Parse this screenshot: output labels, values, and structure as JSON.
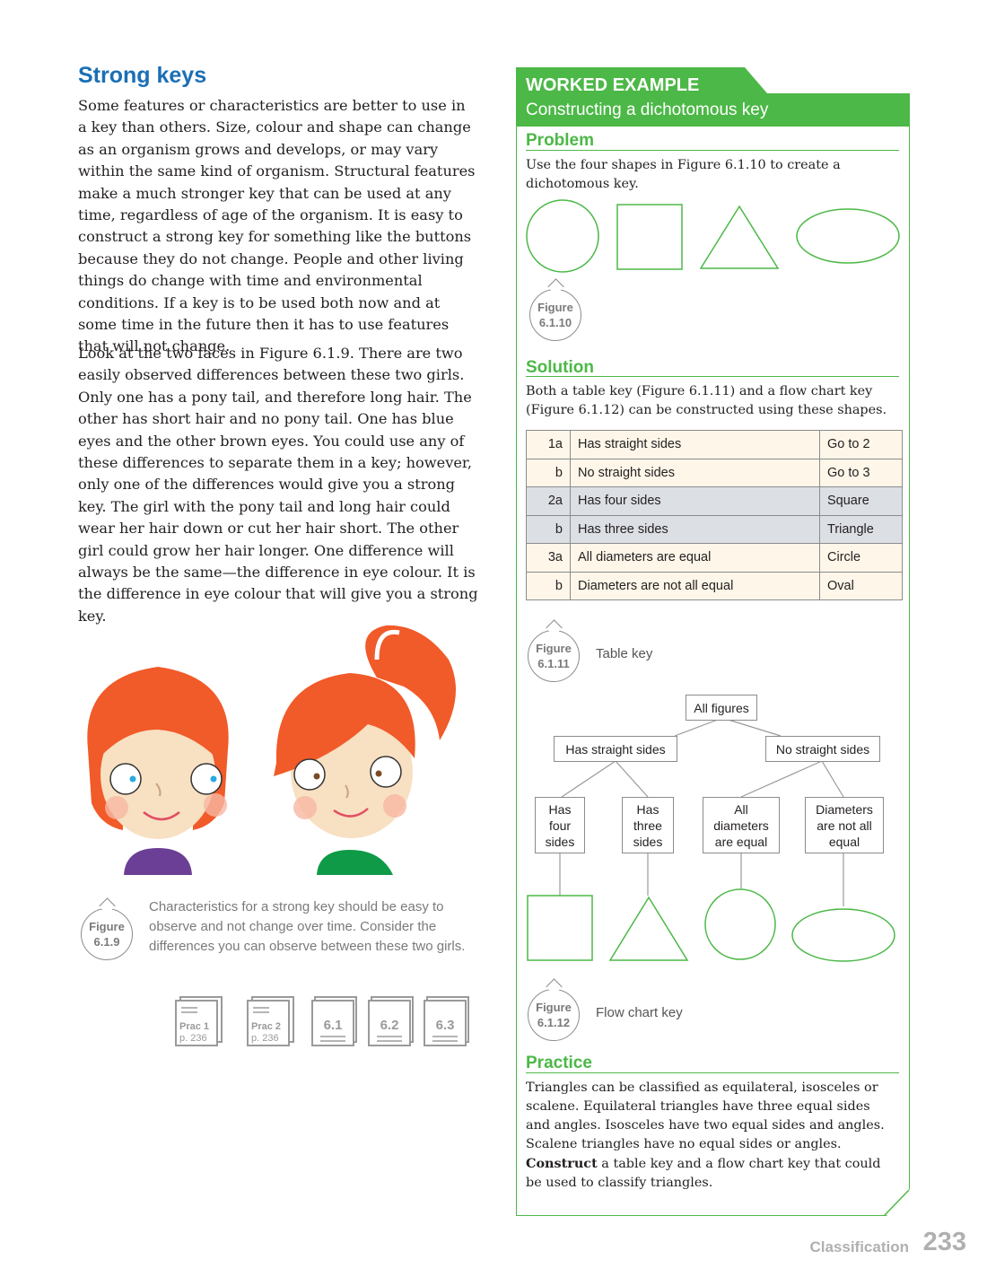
{
  "left": {
    "title": "Strong keys",
    "para1": "Some features or characteristics are better to use in a key than others. Size, colour and shape can change as an organism grows and develops, or may vary within the same kind of organism. Structural features make a much stronger key that can be used at any time, regardless of age of the organism. It is easy to construct a strong key for something like the buttons because they do not change. People and other living things do change with time and environmental conditions. If a key is to be used both now and at some time in the future then it has to use features that will not change.",
    "para2": "Look at the two faces in Figure 6.1.9. There are two easily observed differences between these two girls. Only one has a pony tail, and therefore long hair. The other has short hair and no pony tail. One has blue eyes and the other brown eyes. You could use any of these differences to separate them in a key; however, only one of the differences would give you a strong key. The girl with the pony tail and long hair could wear her hair down or cut her hair short. The other girl could grow her hair longer. One difference will always be the same—the difference in eye colour. It is the difference in eye colour that will give you a strong key.",
    "figure_619": {
      "label": "Figure",
      "number": "6.1.9"
    },
    "caption_619": "Characteristics for a strong key should be easy to observe and not change over time. Consider the differences you can observe between these two girls.",
    "resources": [
      {
        "line1": "Prac 1",
        "line2": "p. 236"
      },
      {
        "line1": "Prac 2",
        "line2": "p. 236"
      },
      {
        "label": "6.1"
      },
      {
        "label": "6.2"
      },
      {
        "label": "6.3"
      }
    ]
  },
  "worked_example": {
    "tab_title": "WORKED EXAMPLE",
    "subtitle": "Constructing a dichotomous key",
    "problem_heading": "Problem",
    "problem_text": "Use the four shapes in Figure 6.1.10 to create a dichotomous key.",
    "figure_6110": {
      "label": "Figure",
      "number": "6.1.10"
    },
    "solution_heading": "Solution",
    "solution_text": "Both a table key (Figure 6.1.11) and a flow chart key (Figure 6.1.12) can be constructed using these shapes.",
    "table_rows": [
      {
        "step": "1a",
        "feature": "Has straight sides",
        "result": "Go to 2"
      },
      {
        "step": "b",
        "feature": "No straight sides",
        "result": "Go to 3"
      },
      {
        "step": "2a",
        "feature": "Has four sides",
        "result": "Square"
      },
      {
        "step": "b",
        "feature": "Has three sides",
        "result": "Triangle"
      },
      {
        "step": "3a",
        "feature": "All diameters are equal",
        "result": "Circle"
      },
      {
        "step": "b",
        "feature": "Diameters are not all equal",
        "result": "Oval"
      }
    ],
    "figure_6111": {
      "label": "Figure",
      "number": "6.1.11",
      "caption": "Table key"
    },
    "flow": {
      "root": "All figures",
      "left": "Has straight sides",
      "right": "No straight sides",
      "leaf1": [
        "Has",
        "four",
        "sides"
      ],
      "leaf2": [
        "Has",
        "three",
        "sides"
      ],
      "leaf3": [
        "All",
        "diameters",
        "are equal"
      ],
      "leaf4": [
        "Diameters",
        "are not all",
        "equal"
      ]
    },
    "figure_6112": {
      "label": "Figure",
      "number": "6.1.12",
      "caption": "Flow chart key"
    },
    "practice_heading": "Practice",
    "practice_text": "Triangles can be classified as equilateral, isosceles or scalene. Equilateral triangles have three equal sides and angles. Isosceles have two equal sides and angles. Scalene triangles have no equal sides or angles.",
    "practice_bold": "Construct",
    "practice_tail": " a table key and a flow chart key that could be used to classify triangles."
  },
  "footer": {
    "label": "Classification",
    "page": "233"
  },
  "colors": {
    "accent_blue": "#1a6fb5",
    "accent_green": "#4cb847",
    "hair": "#f15a29",
    "shirt_purple": "#6b3f95",
    "shirt_green": "#0f9a48"
  }
}
